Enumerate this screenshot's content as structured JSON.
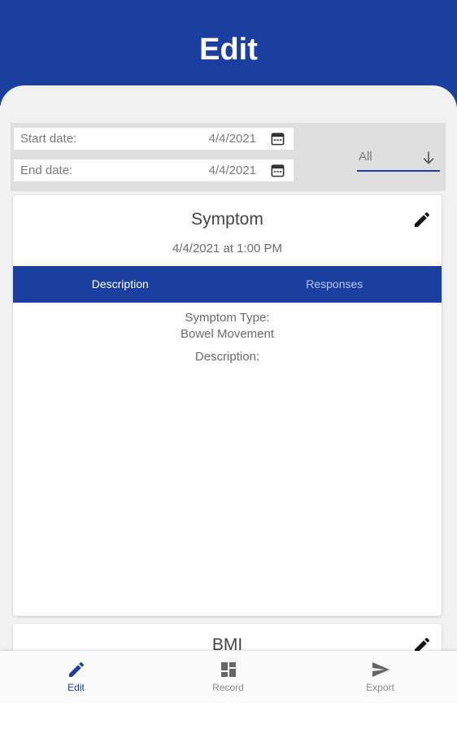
{
  "header": {
    "title": "Edit",
    "color": "#1a3fa0"
  },
  "filters": {
    "start_label": "Start date:",
    "start_value": "4/4/2021",
    "end_label": "End date:",
    "end_value": "4/4/2021",
    "category_value": "All",
    "calendar_icon": "calendar-icon",
    "dropdown_icon": "arrow-down-icon"
  },
  "cards": [
    {
      "title": "Symptom",
      "datetime": "4/4/2021 at 1:00 PM",
      "edit_icon": "pencil-icon",
      "tabs": [
        {
          "label": "Description",
          "active": true
        },
        {
          "label": "Responses",
          "active": false
        }
      ],
      "details": {
        "type_label": "Symptom Type:",
        "type_value": "Bowel Movement",
        "description_label": "Description:"
      }
    },
    {
      "title": "BMI",
      "edit_icon": "pencil-icon"
    }
  ],
  "bottom_nav": {
    "items": [
      {
        "label": "Edit",
        "icon": "pencil-icon",
        "active": true
      },
      {
        "label": "Record",
        "icon": "grid-icon",
        "active": false
      },
      {
        "label": "Export",
        "icon": "send-icon",
        "active": false
      }
    ]
  }
}
